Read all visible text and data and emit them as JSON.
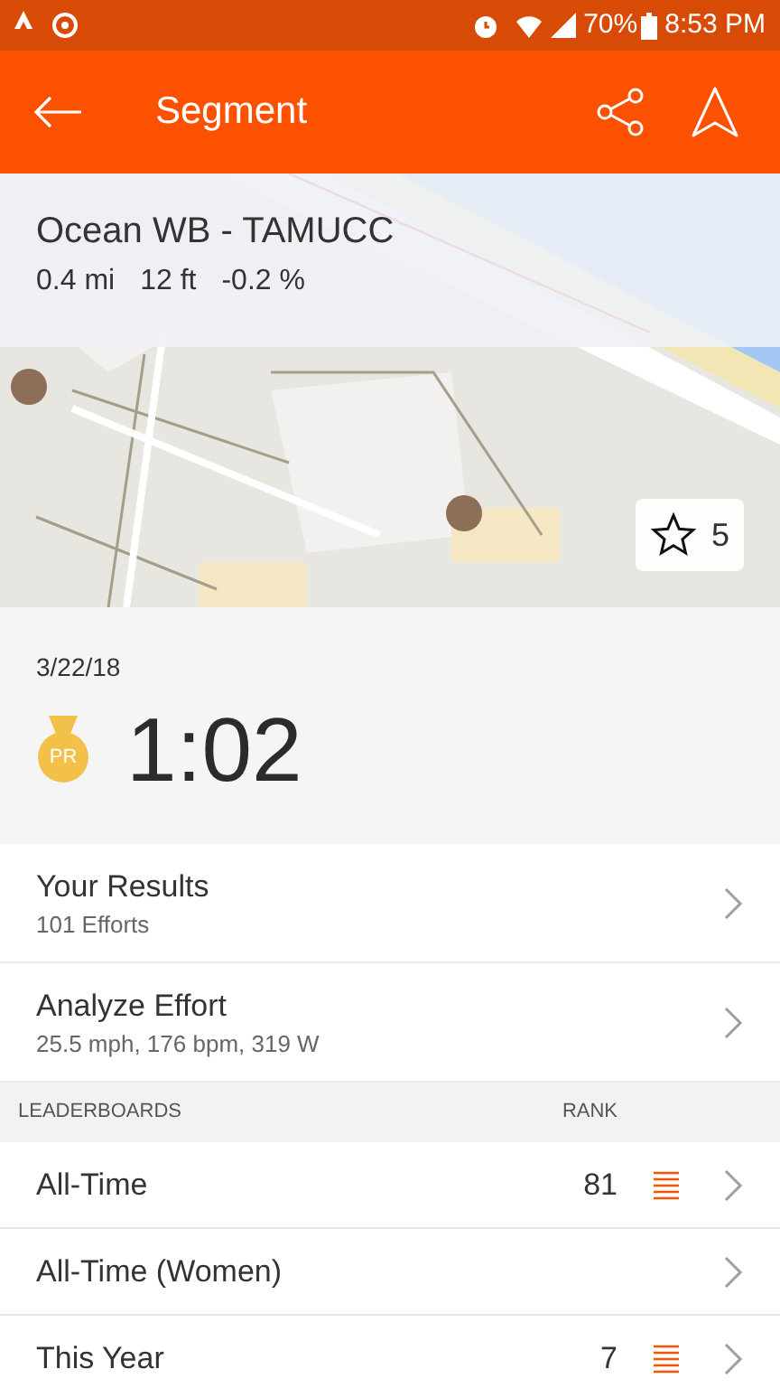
{
  "status_bar": {
    "battery": "70%",
    "time": "8:53 PM"
  },
  "app_bar": {
    "title": "Segment"
  },
  "segment": {
    "name": "Ocean WB - TAMUCC",
    "distance": "0.4 mi",
    "elevation": "12 ft",
    "grade": "-0.2 %"
  },
  "map": {
    "kind": "picture",
    "star_count": "5",
    "starred": false
  },
  "effort": {
    "date": "3/22/18",
    "time": "1:02",
    "badge": "PR"
  },
  "links": [
    {
      "title": "Your Results",
      "subtitle": "101 Efforts"
    },
    {
      "title": "Analyze Effort",
      "subtitle": "25.5 mph, 176 bpm, 319 W"
    }
  ],
  "leaderboards": {
    "header": "LEADERBOARDS",
    "rank_header": "RANK",
    "rows": [
      {
        "label": "All-Time",
        "rank": "81"
      },
      {
        "label": "All-Time (Women)"
      },
      {
        "label": "This Year",
        "rank": "7"
      }
    ]
  }
}
